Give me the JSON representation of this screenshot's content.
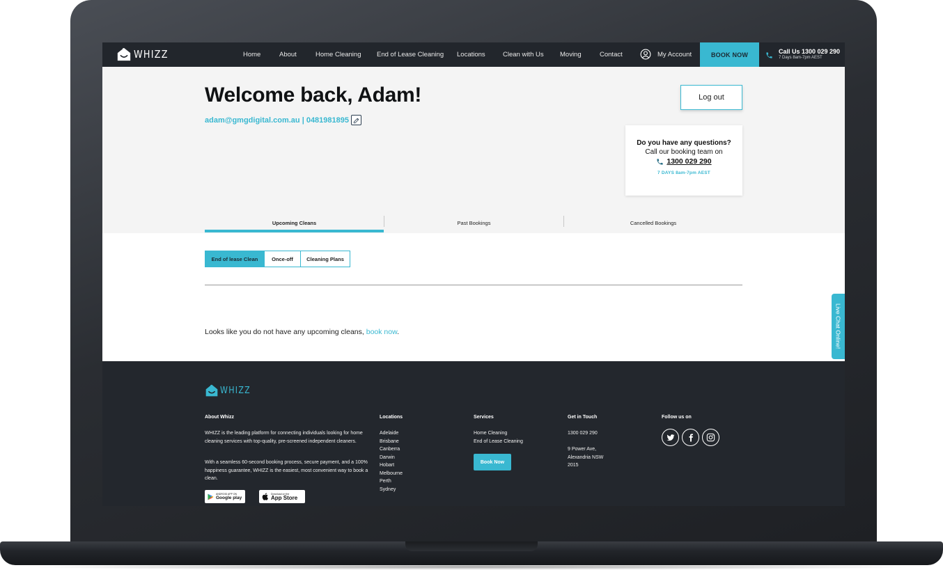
{
  "brand": {
    "name": "WHIZZ"
  },
  "nav": {
    "items": [
      "Home",
      "About",
      "Home Cleaning",
      "End of Lease Cleaning",
      "Locations",
      "Clean with Us",
      "Moving",
      "Contact"
    ],
    "account_label": "My Account",
    "book_label": "BOOK NOW",
    "call_label": "Call Us 1300 029 290",
    "call_hours": "7 Days 8am-7pm AEST"
  },
  "welcome": {
    "title": "Welcome back, Adam!",
    "contact": "adam@gmgdigital.com.au | 0481981895",
    "logout_label": "Log out"
  },
  "help": {
    "line1": "Do you have any questions?",
    "line2": "Call our booking team on",
    "phone": "1300 029 290",
    "hours": "7 DAYS 8am-7pm AEST"
  },
  "tabs": [
    "Upcoming Cleans",
    "Past Bookings",
    "Cancelled Bookings"
  ],
  "active_tab": "Upcoming Cleans",
  "filters": [
    "End of lease Clean",
    "Once-off",
    "Cleaning Plans"
  ],
  "active_filter": "End of lease Clean",
  "empty": {
    "text": "Looks like you do not have any upcoming cleans,",
    "link": "book now",
    "end": "."
  },
  "live_chat": "Live Chat Online!",
  "footer": {
    "about_title": "About Whizz",
    "about_p1": "WHIZZ is the leading platform for connecting individuals looking for home cleaning services with top-quality, pre-screened independent cleaners.",
    "about_p2": "With a seamless 60-second booking process, secure payment, and a 100% happiness guarantee, WHIZZ is the easiest, most convenient way to book a clean.",
    "locations_title": "Locations",
    "locations": [
      "Adelaide",
      "Brisbane",
      "Canberra",
      "Darwin",
      "Hobart",
      "Melbourne",
      "Perth",
      "Sydney"
    ],
    "services_title": "Services",
    "services": [
      "Home Cleaning",
      "End of Lease Cleaning"
    ],
    "services_button": "Book Now",
    "touch_title": "Get in Touch",
    "touch_phone": "1300 029 290",
    "address": [
      "9 Power Ave,",
      "Alexandria NSW",
      "2015"
    ],
    "follow_title": "Follow us on",
    "social_icons": [
      "twitter-icon",
      "facebook-icon",
      "instagram-icon"
    ],
    "google_small": "ANDROID APP ON",
    "google_big": "Google play",
    "apple_small": "Download on the",
    "apple_big": "App Store"
  },
  "colors": {
    "accent": "#39b8d1",
    "dark": "#22262c",
    "page_bg": "#f4f4f4"
  }
}
